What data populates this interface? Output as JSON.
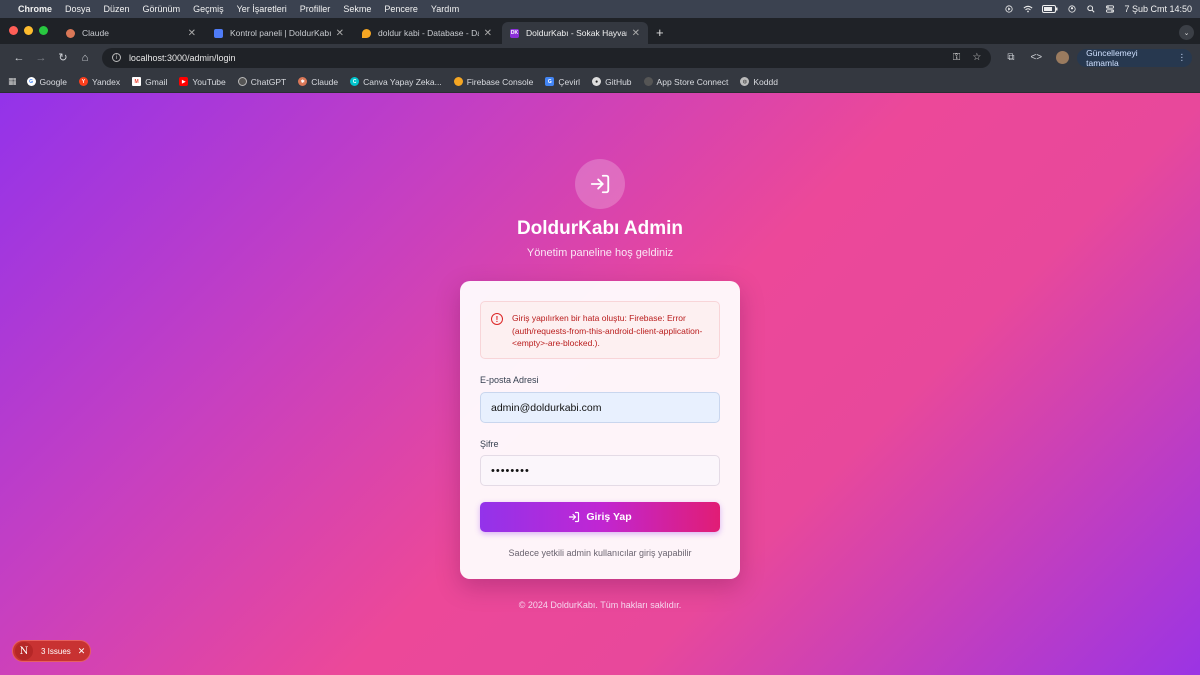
{
  "menubar": {
    "app": "Chrome",
    "items": [
      "Dosya",
      "Düzen",
      "Görünüm",
      "Geçmiş",
      "Yer İşaretleri",
      "Profiller",
      "Sekme",
      "Pencere",
      "Yardım"
    ],
    "clock": "7 Şub Cmt  14:50"
  },
  "tabs": [
    {
      "title": "Claude",
      "favicon_color": "#d97757",
      "icon": "claude-icon"
    },
    {
      "title": "Kontrol paneli | DoldurKabı",
      "favicon_color": "#4f7cf7",
      "icon": "dashboard-icon"
    },
    {
      "title": "doldur kabi - Database - Data",
      "favicon_color": "#f5a623",
      "icon": "firebase-icon"
    },
    {
      "title": "DoldurKabı - Sokak Hayvanları",
      "favicon_color": "#8b2fd8",
      "icon": "dk-icon",
      "favicon_text": "DK"
    }
  ],
  "toolbar": {
    "url": "localhost:3000/admin/login",
    "update_label": "Güncellemeyi tamamla"
  },
  "bookmarks": [
    {
      "label": "Google",
      "color": "#ffffff",
      "icon": "google-icon"
    },
    {
      "label": "Yandex",
      "color": "#fc3f1d",
      "icon": "yandex-icon"
    },
    {
      "label": "Gmail",
      "color": "#ea4335",
      "icon": "gmail-icon"
    },
    {
      "label": "YouTube",
      "color": "#ff0000",
      "icon": "youtube-icon"
    },
    {
      "label": "ChatGPT",
      "color": "#bfbfbf",
      "icon": "chatgpt-icon"
    },
    {
      "label": "Claude",
      "color": "#d97757",
      "icon": "claude-icon"
    },
    {
      "label": "Canva Yapay Zeka...",
      "color": "#00c4cc",
      "icon": "canva-icon"
    },
    {
      "label": "Firebase Console",
      "color": "#f5a623",
      "icon": "firebase-icon"
    },
    {
      "label": "Çevirl",
      "color": "#4285f4",
      "icon": "translate-icon"
    },
    {
      "label": "GitHub",
      "color": "#dddddd",
      "icon": "github-icon"
    },
    {
      "label": "App Store Connect",
      "color": "#555555",
      "icon": "apple-icon"
    },
    {
      "label": "Koddd",
      "color": "#bbbbbb",
      "icon": "globe-icon"
    }
  ],
  "login": {
    "title": "DoldurKabı Admin",
    "subtitle": "Yönetim paneline hoş geldiniz",
    "error": "Giriş yapılırken bir hata oluştu: Firebase: Error (auth/requests-from-this-android-client-application-<empty>-are-blocked.).",
    "email_label": "E-posta Adresi",
    "email_value": "admin@doldurkabi.com",
    "password_label": "Şifre",
    "password_value": "••••••••",
    "submit_label": "Giriş Yap",
    "note": "Sadece yetkili admin kullanıcılar giriş yapabilir",
    "footer": "© 2024 DoldurKabı. Tüm hakları saklıdır."
  },
  "devtools": {
    "badge": "N",
    "issues_label": "3 Issues"
  },
  "colors": {
    "accent_purple": "#9333ea",
    "accent_pink": "#ec4899",
    "error_red": "#dc2626"
  }
}
